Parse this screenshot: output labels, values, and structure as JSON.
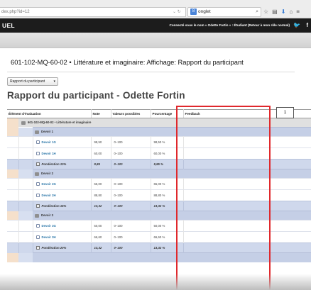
{
  "browser": {
    "url": "dex.php?id=12",
    "search_text": "onglet",
    "search_engine_letter": "8"
  },
  "header": {
    "site_title": "UEL",
    "login_text": "Connecté sous le nom « Odette Fortin » : Étudiant (Retour à mon rôle normal)",
    "twitter": "🐦",
    "facebook": "f"
  },
  "page": {
    "course_title": "601-102-MQ-60-02 • Littérature et imaginaire: Affichage: Rapport du participant",
    "report_select": "Rapport du participant",
    "heading": "Rapport du participant - Odette Fortin",
    "callout": "1"
  },
  "table": {
    "headers": {
      "item": "Élément d'évaluation",
      "grade": "Note",
      "range": "Valeurs possibles",
      "percentage": "Pourcentage",
      "feedback": "Feedback"
    },
    "course_label": "601-102-MQ-60-02 • Littérature et imaginaire",
    "categories": [
      {
        "name": "Devoir 1",
        "items": [
          {
            "name": "Devoir 1G",
            "grade": "98,50",
            "range": "0–100",
            "percentage": "98,50 %"
          },
          {
            "name": "Devoir 1H",
            "grade": "60,00",
            "range": "0–100",
            "percentage": "60,00 %"
          }
        ],
        "total": {
          "label": "Pondération 10%",
          "grade": "9,85",
          "range": "0–100",
          "percentage": "9,85 %"
        }
      },
      {
        "name": "Devoir 2",
        "items": [
          {
            "name": "Devoir 2G",
            "grade": "65,00",
            "range": "0–100",
            "percentage": "65,00 %"
          },
          {
            "name": "Devoir 2H",
            "grade": "88,80",
            "range": "0–100",
            "percentage": "88,80 %"
          }
        ],
        "total": {
          "label": "Pondération 15%",
          "grade": "13,32",
          "range": "0–100",
          "percentage": "13,32 %"
        }
      },
      {
        "name": "Devoir 3",
        "items": [
          {
            "name": "Devoir 3G",
            "grade": "50,00",
            "range": "0–100",
            "percentage": "50,00 %"
          },
          {
            "name": "Devoir 3H",
            "grade": "66,60",
            "range": "0–100",
            "percentage": "66,60 %"
          }
        ],
        "total": {
          "label": "Pondération 20%",
          "grade": "13,32",
          "range": "0–100",
          "percentage": "13,32 %"
        }
      }
    ]
  }
}
